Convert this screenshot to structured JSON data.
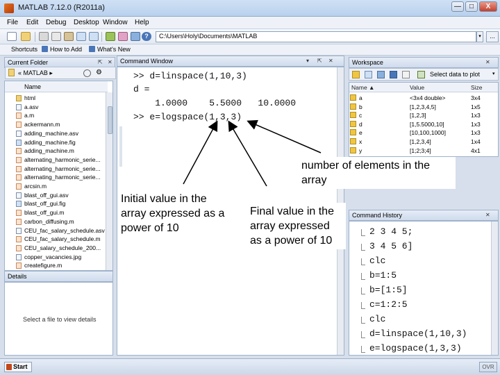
{
  "window": {
    "title": "MATLAB 7.12.0 (R2011a)",
    "minimize": "—",
    "maximize": "□",
    "close": "X"
  },
  "menu": [
    "File",
    "Edit",
    "Debug",
    "Desktop",
    "Window",
    "Help"
  ],
  "toolbar": {
    "path_value": "C:\\Users\\Holy\\Documents\\MATLAB",
    "browse_label": "...",
    "dropdown_label": "▾",
    "help_label": "?"
  },
  "shortcuts": {
    "items": [
      "Shortcuts",
      "How to Add",
      "What's New"
    ]
  },
  "current_folder": {
    "title": "Current Folder",
    "nav_label": "« MATLAB ▸",
    "column_name": "Name",
    "files": [
      {
        "name": "html",
        "type": "folder"
      },
      {
        "name": "a.asv",
        "type": "file"
      },
      {
        "name": "a.m",
        "type": "mfile"
      },
      {
        "name": "ackermann.m",
        "type": "mfile"
      },
      {
        "name": "adding_machine.asv",
        "type": "file"
      },
      {
        "name": "adding_machine.fig",
        "type": "fig"
      },
      {
        "name": "adding_machine.m",
        "type": "mfile"
      },
      {
        "name": "alternating_harmonic_serie...",
        "type": "mfile"
      },
      {
        "name": "alternating_harmonic_serie...",
        "type": "mfile"
      },
      {
        "name": "alternating_harmonic_serie...",
        "type": "mfile"
      },
      {
        "name": "arcsin.m",
        "type": "mfile"
      },
      {
        "name": "blast_off_gui.asv",
        "type": "file"
      },
      {
        "name": "blast_off_gui.fig",
        "type": "fig"
      },
      {
        "name": "blast_off_gui.m",
        "type": "mfile"
      },
      {
        "name": "carbon_diffusing.m",
        "type": "mfile"
      },
      {
        "name": "CEU_fac_salary_schedule.asv",
        "type": "file"
      },
      {
        "name": "CEU_fac_salary_schedule.m",
        "type": "mfile"
      },
      {
        "name": "CEU_salary_schedule_200...",
        "type": "mfile"
      },
      {
        "name": "copper_vacancies.jpg",
        "type": "file"
      },
      {
        "name": "createfigure.m",
        "type": "mfile"
      }
    ],
    "details_title": "Details",
    "details_hint": "Select a file to view details"
  },
  "command_window": {
    "title": "Command Window",
    "lines": [
      ">> d=linspace(1,10,3)",
      "d =",
      "    1.0000    5.5000   10.0000",
      ">> e=logspace(1,3,3)"
    ]
  },
  "workspace": {
    "title": "Workspace",
    "select_label": "Select data to plot",
    "columns": [
      "Name ▲",
      "Value",
      "Size"
    ],
    "rows": [
      {
        "name": "a",
        "value": "<3x4 double>",
        "size": "3x4"
      },
      {
        "name": "b",
        "value": "[1,2,3,4,5]",
        "size": "1x5"
      },
      {
        "name": "c",
        "value": "[1,2,3]",
        "size": "1x3"
      },
      {
        "name": "d",
        "value": "[1,5.5000,10]",
        "size": "1x3"
      },
      {
        "name": "e",
        "value": "[10,100,1000]",
        "size": "1x3"
      },
      {
        "name": "x",
        "value": "[1,2,3,4]",
        "size": "1x4"
      },
      {
        "name": "y",
        "value": "[1;2;3;4]",
        "size": "4x1"
      }
    ]
  },
  "command_history": {
    "title": "Command History",
    "lines": [
      "2 3 4 5;",
      "3 4 5 6]",
      "clc",
      "b=1:5",
      "b=[1:5]",
      "c=1:2:5",
      "clc",
      "d=linspace(1,10,3)",
      "e=logspace(1,3,3)"
    ]
  },
  "annotations": {
    "elements": "number of elements in the array",
    "initial": "Initial value in the array expressed as a power of 10",
    "final": "Final value in the array expressed as a power of 10"
  },
  "status": {
    "start": "Start",
    "ovr": "OVR"
  },
  "colors": {
    "titlebar": "#b9d1ee",
    "pane_border": "#9fb2cc",
    "workspace_icon": "#f0c542"
  }
}
